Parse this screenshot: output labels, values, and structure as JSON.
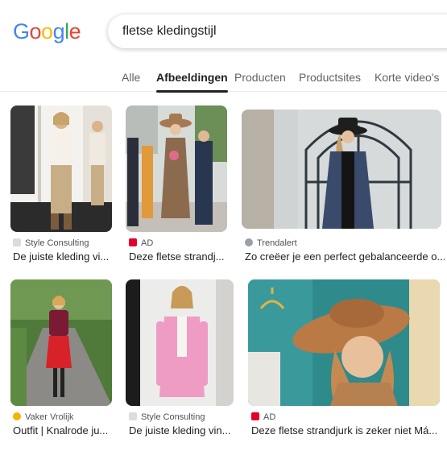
{
  "logo": {
    "letters": [
      "G",
      "o",
      "o",
      "g",
      "l",
      "e"
    ],
    "colors": [
      "#4285F4",
      "#EA4335",
      "#FBBC05",
      "#4285F4",
      "#34A853",
      "#EA4335"
    ]
  },
  "search": {
    "query": "fletse kledingstijl"
  },
  "tabs": [
    "Alle",
    "Afbeeldingen",
    "Producten",
    "Productsites",
    "Korte video's"
  ],
  "active_tab": "Afbeeldingen",
  "results": [
    {
      "source": "Style Consulting",
      "title": "De juiste kleding vi...",
      "favicon": "page-icon"
    },
    {
      "source": "AD",
      "title": "Deze fletse strandj...",
      "favicon": "ad-logo-icon"
    },
    {
      "source": "Trendalert",
      "title": "Zo creëer je een perfect gebalanceerde o...",
      "favicon": "trendalert-icon"
    },
    {
      "source": "Vaker Vrolijk",
      "title": "Outfit | Knalrode ju...",
      "favicon": "sun-icon"
    },
    {
      "source": "Style Consulting",
      "title": "De juiste kleding vin...",
      "favicon": "page-icon"
    },
    {
      "source": "AD",
      "title": "Deze fletse strandjurk is zeker niet Má...",
      "favicon": "ad-logo-icon"
    }
  ]
}
